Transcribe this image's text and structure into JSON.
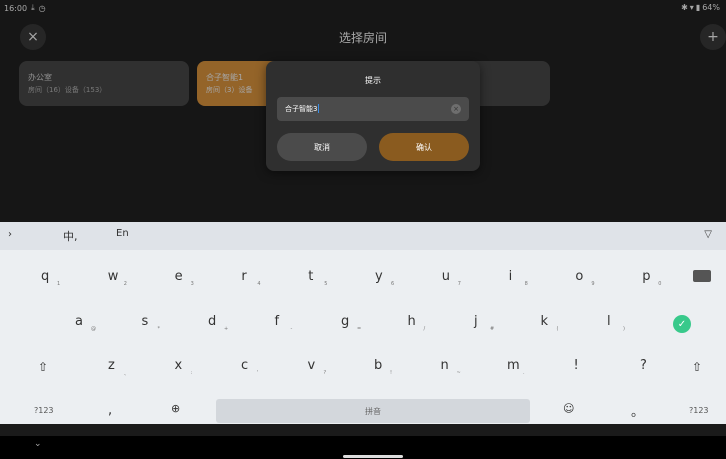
{
  "status": {
    "time": "16:00",
    "battery": "64%"
  },
  "header": {
    "title": "选择房间",
    "close_icon": "×",
    "add_icon": "+"
  },
  "rooms": [
    {
      "name": "办公室",
      "meta": "房间（16）设备（153）"
    },
    {
      "name": "合子智能1",
      "meta": "房间（3）设备"
    }
  ],
  "dialog": {
    "title": "提示",
    "input_value": "合子智能3",
    "cancel_label": "取消",
    "confirm_label": "确认"
  },
  "keyboard": {
    "lang_zh": "中,",
    "lang_en": "En",
    "row1": [
      {
        "k": "q",
        "s": "1"
      },
      {
        "k": "w",
        "s": "2"
      },
      {
        "k": "e",
        "s": "3"
      },
      {
        "k": "r",
        "s": "4"
      },
      {
        "k": "t",
        "s": "5"
      },
      {
        "k": "y",
        "s": "6"
      },
      {
        "k": "u",
        "s": "7"
      },
      {
        "k": "i",
        "s": "8"
      },
      {
        "k": "o",
        "s": "9"
      },
      {
        "k": "p",
        "s": "0"
      }
    ],
    "row2": [
      {
        "k": "a",
        "s": "@"
      },
      {
        "k": "s",
        "s": "*"
      },
      {
        "k": "d",
        "s": "+"
      },
      {
        "k": "f",
        "s": "-"
      },
      {
        "k": "g",
        "s": "="
      },
      {
        "k": "h",
        "s": "/"
      },
      {
        "k": "j",
        "s": "#"
      },
      {
        "k": "k",
        "s": "("
      },
      {
        "k": "l",
        "s": ")"
      }
    ],
    "row3": [
      {
        "k": "z",
        "s": "、"
      },
      {
        "k": "x",
        "s": ":"
      },
      {
        "k": "c",
        "s": "'"
      },
      {
        "k": "v",
        "s": "?"
      },
      {
        "k": "b",
        "s": "!"
      },
      {
        "k": "n",
        "s": "~"
      },
      {
        "k": "m",
        "s": "."
      },
      {
        "k": "!",
        "s": ""
      },
      {
        "k": "?",
        "s": ""
      }
    ],
    "row4": {
      "num_left": "?123",
      "comma": ",",
      "space": "拼音",
      "period": "。",
      "num_right": "?123"
    }
  },
  "colors": {
    "accent": "#e39a40",
    "confirm": "#8a5b1f",
    "done": "#38c98b"
  }
}
